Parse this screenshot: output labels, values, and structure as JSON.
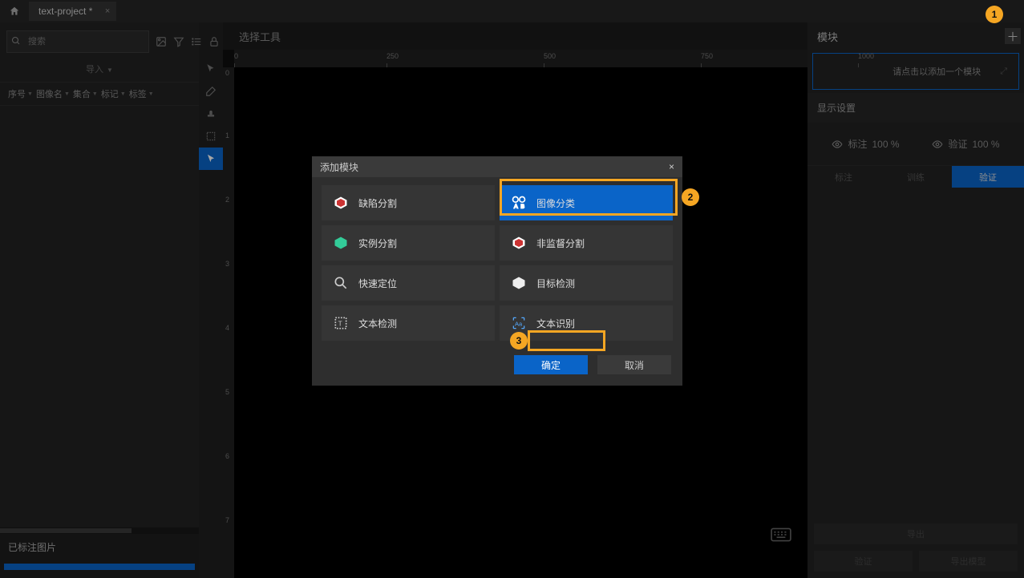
{
  "title": {
    "project": "text-project *"
  },
  "sidebar": {
    "search_placeholder": "搜索",
    "import_label": "导入",
    "cols": {
      "seq": "序号",
      "image": "图像名",
      "set": "集合",
      "mark": "标记",
      "label": "标签"
    },
    "footer_title": "已标注图片"
  },
  "canvas": {
    "title": "选择工具",
    "ruler_h": [
      "0",
      "250",
      "500",
      "750",
      "1000"
    ],
    "ruler_v": [
      "0",
      "1",
      "2",
      "3",
      "4",
      "5",
      "6",
      "7"
    ]
  },
  "right": {
    "title": "模块",
    "add_prompt": "请点击以添加一个模块",
    "display_title": "显示设置",
    "display": {
      "label": "标注",
      "label_pct": "100 %",
      "verify": "验证",
      "verify_pct": "100 %"
    },
    "tabs": {
      "t1": "标注",
      "t2": "训练",
      "t3": "验证"
    },
    "foot": {
      "b1": "导出",
      "b2": "验证",
      "b3": "导出模型"
    }
  },
  "modal": {
    "title": "添加模块",
    "options": {
      "defect_seg": "缺陷分割",
      "image_cls": "图像分类",
      "instance_seg": "实例分割",
      "unsup_seg": "非监督分割",
      "quick_loc": "快速定位",
      "obj_det": "目标检测",
      "text_det": "文本检测",
      "text_rec": "文本识别"
    },
    "ok": "确定",
    "cancel": "取消"
  },
  "callouts": {
    "c1": "1",
    "c2": "2",
    "c3": "3"
  }
}
